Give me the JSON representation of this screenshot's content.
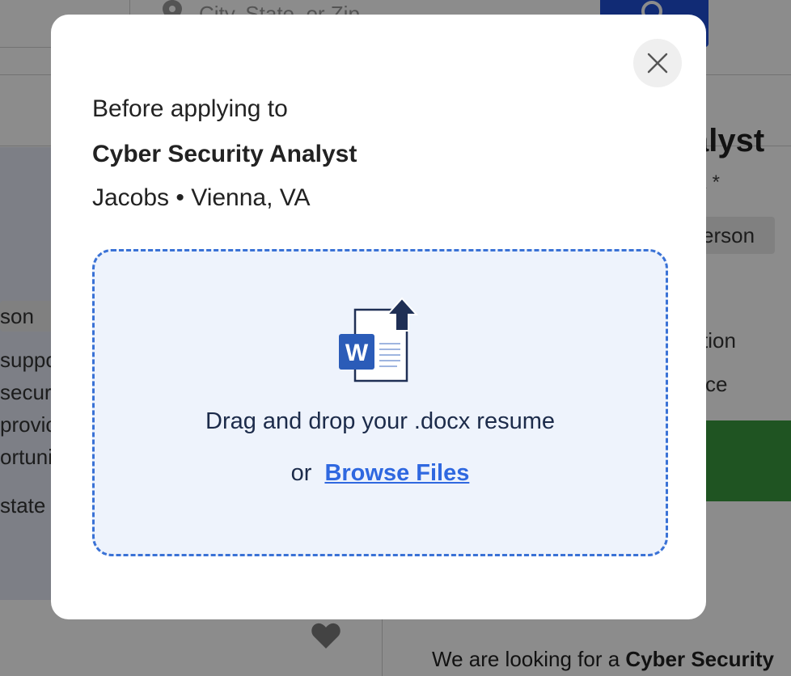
{
  "background": {
    "location_placeholder": "City, State, or Zip",
    "left_chip": "son",
    "left_snippets": [
      "suppo",
      "secur",
      "provic",
      "ortuni",
      "state"
    ],
    "right_title": "alyst",
    "right_subtitle": "K *",
    "right_chip": "erson",
    "right_snippets": [
      "tion",
      "ce"
    ],
    "description_prefix": "We are looking for a ",
    "description_bold": "Cyber Security"
  },
  "modal": {
    "before_text": "Before applying to",
    "job_title": "Cyber Security Analyst",
    "job_meta": "Jacobs • Vienna, VA",
    "dropzone": {
      "icon_letter": "W",
      "instruction": "Drag and drop your .docx resume",
      "or_text": "or",
      "browse_label": "Browse Files"
    }
  },
  "colors": {
    "accent": "#2f68e0",
    "dropzone_border": "#3a72d6",
    "dropzone_bg": "#eef3fc",
    "word_blue": "#2b5cb8",
    "upload_arrow": "#1f2f55",
    "apply_green": "#3a9a3e"
  },
  "icons": {
    "close": "close-icon",
    "document_upload": "word-document-upload-icon",
    "location": "location-pin-icon",
    "search": "search-icon",
    "favorite": "heart-icon"
  }
}
